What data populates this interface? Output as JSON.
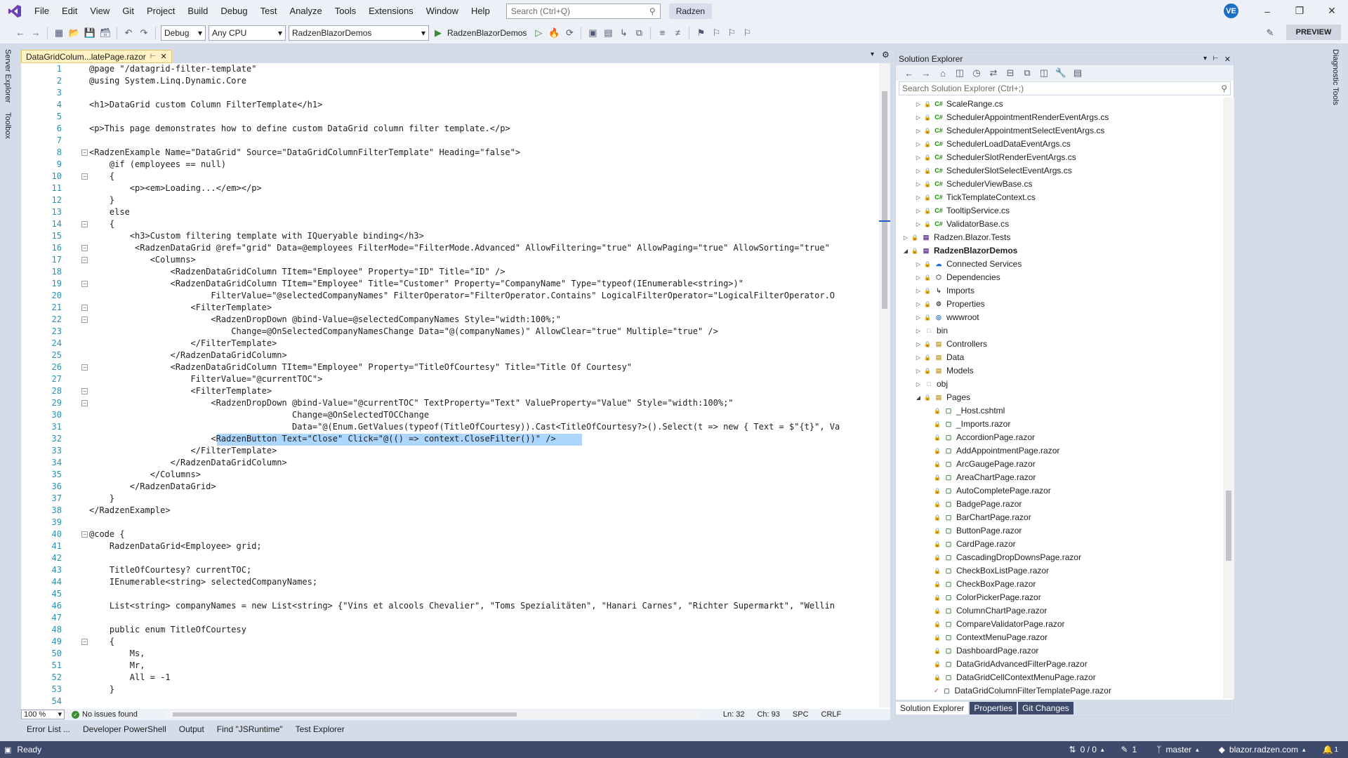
{
  "menubar": {
    "items": [
      "File",
      "Edit",
      "View",
      "Git",
      "Project",
      "Build",
      "Debug",
      "Test",
      "Analyze",
      "Tools",
      "Extensions",
      "Window",
      "Help"
    ],
    "search_placeholder": "Search (Ctrl+Q)",
    "solution_name": "Radzen",
    "avatar_initials": "VE"
  },
  "toolbar": {
    "config": "Debug",
    "platform": "Any CPU",
    "project": "RadzenBlazorDemos",
    "run_target": "RadzenBlazorDemos",
    "preview_label": "PREVIEW"
  },
  "side_tabs": {
    "left": [
      "Server Explorer",
      "Toolbox"
    ],
    "right": [
      "Diagnostic Tools"
    ]
  },
  "editor": {
    "tab_label": "DataGridColum...latePage.razor",
    "zoom": "100 %",
    "issues": "No issues found",
    "line": "Ln: 32",
    "col": "Ch: 93",
    "spc": "SPC",
    "eol": "CRLF",
    "lines": [
      "@page \"/datagrid-filter-template\"",
      "@using System.Linq.Dynamic.Core",
      "",
      "<h1>DataGrid custom Column FilterTemplate</h1>",
      "",
      "<p>This page demonstrates how to define custom DataGrid column filter template.</p>",
      "",
      "<RadzenExample Name=\"DataGrid\" Source=\"DataGridColumnFilterTemplate\" Heading=\"false\">",
      "    @if (employees == null)",
      "    {",
      "        <p><em>Loading...</em></p>",
      "    }",
      "    else",
      "    {",
      "        <h3>Custom filtering template with IQueryable binding</h3>",
      "         <RadzenDataGrid @ref=\"grid\" Data=@employees FilterMode=\"FilterMode.Advanced\" AllowFiltering=\"true\" AllowPaging=\"true\" AllowSorting=\"true\" ",
      "            <Columns>",
      "                <RadzenDataGridColumn TItem=\"Employee\" Property=\"ID\" Title=\"ID\" />",
      "                <RadzenDataGridColumn TItem=\"Employee\" Title=\"Customer\" Property=\"CompanyName\" Type=\"typeof(IEnumerable<string>)\"",
      "                        FilterValue=\"@selectedCompanyNames\" FilterOperator=\"FilterOperator.Contains\" LogicalFilterOperator=\"LogicalFilterOperator.O",
      "                    <FilterTemplate>",
      "                        <RadzenDropDown @bind-Value=@selectedCompanyNames Style=\"width:100%;\"",
      "                            Change=@OnSelectedCompanyNamesChange Data=\"@(companyNames)\" AllowClear=\"true\" Multiple=\"true\" />",
      "                    </FilterTemplate>",
      "                </RadzenDataGridColumn>",
      "                <RadzenDataGridColumn TItem=\"Employee\" Property=\"TitleOfCourtesy\" Title=\"Title Of Courtesy\"",
      "                    FilterValue=\"@currentTOC\">",
      "                    <FilterTemplate>",
      "                        <RadzenDropDown @bind-Value=\"@currentTOC\" TextProperty=\"Text\" ValueProperty=\"Value\" Style=\"width:100%;\"",
      "                                        Change=@OnSelectedTOCChange",
      "                                        Data=\"@(Enum.GetValues(typeof(TitleOfCourtesy)).Cast<TitleOfCourtesy?>().Select(t => new { Text = $\"{t}\", Va",
      "                        <RadzenButton Text=\"Close\" Click=\"@(() => context.CloseFilter())\" />",
      "                    </FilterTemplate>",
      "                </RadzenDataGridColumn>",
      "            </Columns>",
      "        </RadzenDataGrid>",
      "    }",
      "</RadzenExample>",
      "",
      "@code {",
      "    RadzenDataGrid<Employee> grid;",
      "",
      "    TitleOfCourtesy? currentTOC;",
      "    IEnumerable<string> selectedCompanyNames;",
      "",
      "    List<string> companyNames = new List<string> {\"Vins et alcools Chevalier\", \"Toms Spezialitäten\", \"Hanari Carnes\", \"Richter Supermarkt\", \"Wellin",
      "",
      "    public enum TitleOfCourtesy",
      "    {",
      "        Ms,",
      "        Mr,",
      "        All = -1",
      "    }",
      ""
    ]
  },
  "solution_explorer": {
    "title": "Solution Explorer",
    "search_placeholder": "Search Solution Explorer (Ctrl+;)",
    "items": [
      {
        "label": "ScaleRange.cs",
        "kind": "cs",
        "depth": 2
      },
      {
        "label": "SchedulerAppointmentRenderEventArgs.cs",
        "kind": "cs",
        "depth": 2
      },
      {
        "label": "SchedulerAppointmentSelectEventArgs.cs",
        "kind": "cs",
        "depth": 2
      },
      {
        "label": "SchedulerLoadDataEventArgs.cs",
        "kind": "cs",
        "depth": 2
      },
      {
        "label": "SchedulerSlotRenderEventArgs.cs",
        "kind": "cs",
        "depth": 2
      },
      {
        "label": "SchedulerSlotSelectEventArgs.cs",
        "kind": "cs",
        "depth": 2
      },
      {
        "label": "SchedulerViewBase.cs",
        "kind": "cs",
        "depth": 2
      },
      {
        "label": "TickTemplateContext.cs",
        "kind": "cs",
        "depth": 2
      },
      {
        "label": "TooltipService.cs",
        "kind": "cs",
        "depth": 2
      },
      {
        "label": "ValidatorBase.cs",
        "kind": "cs",
        "depth": 2
      },
      {
        "label": "Radzen.Blazor.Tests",
        "kind": "project",
        "depth": 1
      },
      {
        "label": "RadzenBlazorDemos",
        "kind": "project-open",
        "depth": 1
      },
      {
        "label": "Connected Services",
        "kind": "services",
        "depth": 2
      },
      {
        "label": "Dependencies",
        "kind": "deps",
        "depth": 2
      },
      {
        "label": "Imports",
        "kind": "imports",
        "depth": 2
      },
      {
        "label": "Properties",
        "kind": "props",
        "depth": 2
      },
      {
        "label": "wwwroot",
        "kind": "globe",
        "depth": 2
      },
      {
        "label": "bin",
        "kind": "folder-plain",
        "depth": 2
      },
      {
        "label": "Controllers",
        "kind": "folder",
        "depth": 2
      },
      {
        "label": "Data",
        "kind": "folder",
        "depth": 2
      },
      {
        "label": "Models",
        "kind": "folder",
        "depth": 2
      },
      {
        "label": "obj",
        "kind": "folder-plain",
        "depth": 2
      },
      {
        "label": "Pages",
        "kind": "folder-open",
        "depth": 2
      },
      {
        "label": "_Host.cshtml",
        "kind": "file",
        "depth": 3
      },
      {
        "label": "_Imports.razor",
        "kind": "file",
        "depth": 3
      },
      {
        "label": "AccordionPage.razor",
        "kind": "file",
        "depth": 3
      },
      {
        "label": "AddAppointmentPage.razor",
        "kind": "file",
        "depth": 3
      },
      {
        "label": "ArcGaugePage.razor",
        "kind": "file",
        "depth": 3
      },
      {
        "label": "AreaChartPage.razor",
        "kind": "file",
        "depth": 3
      },
      {
        "label": "AutoCompletePage.razor",
        "kind": "file",
        "depth": 3
      },
      {
        "label": "BadgePage.razor",
        "kind": "file",
        "depth": 3
      },
      {
        "label": "BarChartPage.razor",
        "kind": "file",
        "depth": 3
      },
      {
        "label": "ButtonPage.razor",
        "kind": "file",
        "depth": 3
      },
      {
        "label": "CardPage.razor",
        "kind": "file",
        "depth": 3
      },
      {
        "label": "CascadingDropDownsPage.razor",
        "kind": "file",
        "depth": 3
      },
      {
        "label": "CheckBoxListPage.razor",
        "kind": "file",
        "depth": 3
      },
      {
        "label": "CheckBoxPage.razor",
        "kind": "file",
        "depth": 3
      },
      {
        "label": "ColorPickerPage.razor",
        "kind": "file",
        "depth": 3
      },
      {
        "label": "ColumnChartPage.razor",
        "kind": "file",
        "depth": 3
      },
      {
        "label": "CompareValidatorPage.razor",
        "kind": "file",
        "depth": 3
      },
      {
        "label": "ContextMenuPage.razor",
        "kind": "file",
        "depth": 3
      },
      {
        "label": "DashboardPage.razor",
        "kind": "file",
        "depth": 3
      },
      {
        "label": "DataGridAdvancedFilterPage.razor",
        "kind": "file",
        "depth": 3
      },
      {
        "label": "DataGridCellContextMenuPage.razor",
        "kind": "file",
        "depth": 3
      },
      {
        "label": "DataGridColumnFilterTemplatePage.razor",
        "kind": "file-edited",
        "depth": 3
      }
    ],
    "tabs": [
      "Solution Explorer",
      "Properties",
      "Git Changes"
    ]
  },
  "bottom_tabs": [
    "Error List ...",
    "Developer PowerShell",
    "Output",
    "Find \"JSRuntime\"",
    "Test Explorer"
  ],
  "statusbar": {
    "ready": "Ready",
    "sync": "0 / 0",
    "edits": "1",
    "branch": "master",
    "repo": "blazor.radzen.com",
    "notifications": "1"
  }
}
